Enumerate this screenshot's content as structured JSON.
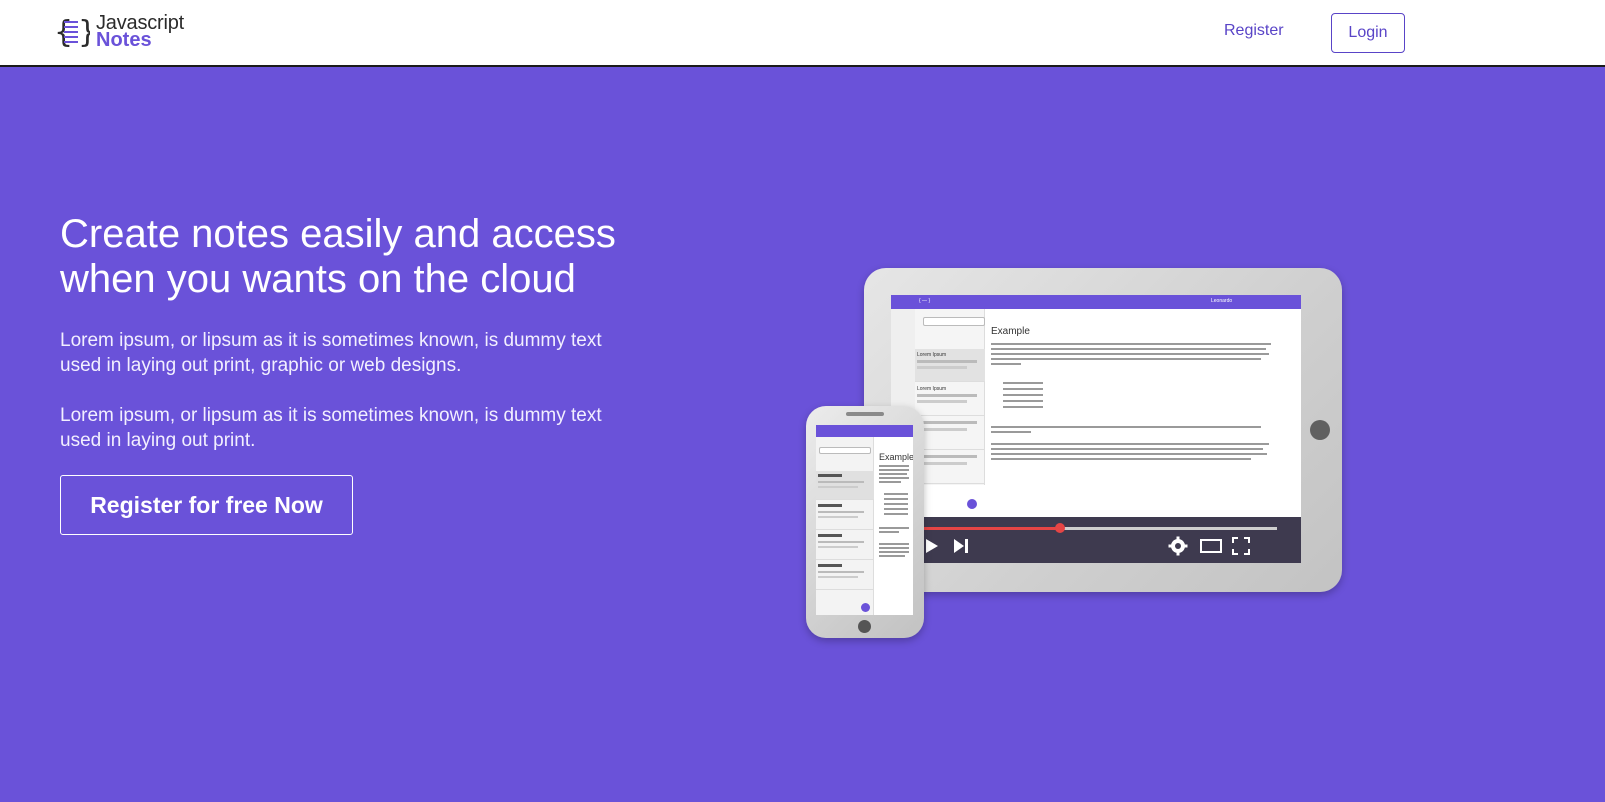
{
  "brand": {
    "name_line1": "Javascript",
    "name_line2": "Notes",
    "accent": "#6a52d9"
  },
  "nav": {
    "register_label": "Register",
    "login_label": "Login"
  },
  "hero": {
    "title": "Create notes easily and access when you wants on the cloud",
    "paragraph1": "Lorem ipsum, or lipsum as it is sometimes known, is dummy text used in laying out print, graphic or web designs.",
    "paragraph2": "Lorem ipsum, or lipsum as it is sometimes known, is dummy text used in laying out print.",
    "cta_label": "Register for free Now",
    "background": "#6a52d9"
  },
  "illustration": {
    "tablet_doc_title": "Example",
    "tablet_user": "Leonardo",
    "tablet_list_item": "Lorem Ipsum",
    "phone_doc_title": "Example",
    "player_progress": 0.37
  }
}
